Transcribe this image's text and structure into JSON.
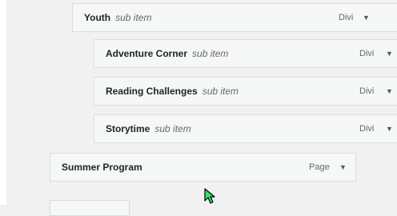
{
  "menu": {
    "items": [
      {
        "title": "Youth",
        "sub": "sub item",
        "type": "Divi"
      },
      {
        "title": "Adventure Corner",
        "sub": "sub item",
        "type": "Divi"
      },
      {
        "title": "Reading Challenges",
        "sub": "sub item",
        "type": "Divi"
      },
      {
        "title": "Storytime",
        "sub": "sub item",
        "type": "Divi"
      },
      {
        "title": "Summer Program",
        "type": "Page"
      }
    ]
  },
  "icons": {
    "arrow": "▼",
    "cursor": "mouse-pointer-icon"
  },
  "colors": {
    "background": "#f1f1f1",
    "item_background": "#f6f7f7",
    "item_border": "#dcdcde",
    "cursor": "#2ee66b"
  }
}
